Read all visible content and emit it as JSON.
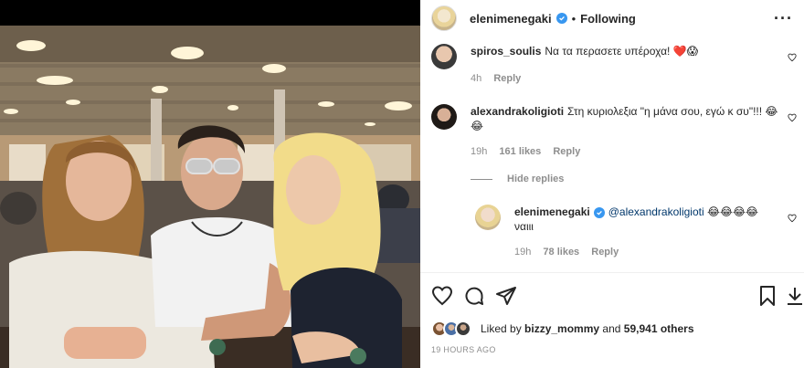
{
  "header": {
    "username": "elenimenegaki",
    "separator": "•",
    "follow_status": "Following",
    "more_glyph": "···"
  },
  "comments": [
    {
      "username": "spiros_soulis",
      "text": "Να τα περασετε υπέροχα! ❤️😱",
      "time": "4h",
      "reply_label": "Reply"
    },
    {
      "username": "alexandrakoligioti",
      "text": "Στη κυριολεξια \"η μάνα σου, εγώ κ συ\"!!! 😂😂",
      "time": "19h",
      "likes": "161 likes",
      "reply_label": "Reply"
    }
  ],
  "hide_replies_label": "Hide replies",
  "reply": {
    "username": "elenimenegaki",
    "mention": "@alexandrakoligioti",
    "emojis": "😂😂😂😂",
    "text2": "ναιιι",
    "time": "19h",
    "likes": "78 likes",
    "reply_label": "Reply"
  },
  "likes": {
    "prefix": "Liked by",
    "user": "bizzy_mommy",
    "and": "and",
    "count": "59,941 others"
  },
  "timestamp": "19 HOURS AGO",
  "colors": {
    "verified_blue": "#3897f0",
    "meta_gray": "#8e8e8e",
    "text": "#262626"
  },
  "icons": [
    "heart-icon",
    "comment-icon",
    "share-icon",
    "bookmark-icon",
    "more-icon"
  ]
}
